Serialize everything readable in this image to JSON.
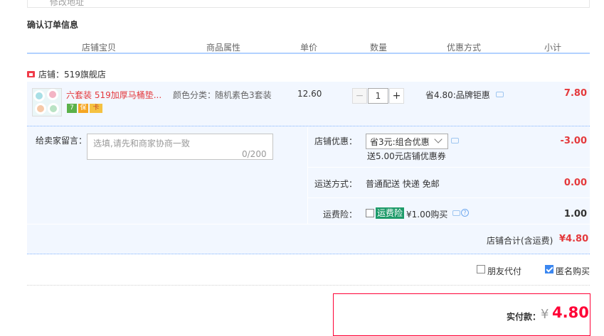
{
  "top": {
    "cut_text": "修改地址"
  },
  "section_title": "确认订单信息",
  "columns": [
    "店铺宝贝",
    "商品属性",
    "单价",
    "数量",
    "优惠方式",
    "小计"
  ],
  "store": {
    "label": "店铺：519旗舰店"
  },
  "item": {
    "title": "六套装 519加厚马桶垫...",
    "attr_label": "颜色分类：",
    "attr_value": "随机素色3套装",
    "price": "12.60",
    "qty": "1",
    "qty_minus": "−",
    "qty_plus": "+",
    "discount": "省4.80:品牌钜惠",
    "subtotal": "7.80",
    "badges": [
      "7",
      "保",
      "卡"
    ]
  },
  "message": {
    "label": "给卖家留言：",
    "placeholder": "选填,请先和商家协商一致",
    "count": "0/200"
  },
  "promo": {
    "label": "店铺优惠：",
    "selected": "省3元:组合优惠",
    "sub": "送5.00元店铺优惠券",
    "amount": "-3.00"
  },
  "shipping": {
    "label": "运送方式：",
    "value": "普通配送 快递 免邮",
    "amount": "0.00"
  },
  "insurance": {
    "label": "运费险：",
    "tag": "运费险",
    "price": "¥1.00购买",
    "amount": "1.00"
  },
  "store_total": {
    "label": "店铺合计(含运费)",
    "amount": "¥4.80"
  },
  "options": {
    "friend_pay": "朋友代付",
    "anonymous": "匿名购买"
  },
  "payment": {
    "label": "实付款：",
    "currency": "¥",
    "amount": "4.80"
  },
  "colors": {
    "price_red": "#e4393c",
    "pay_red": "#ff0036",
    "panel_bg": "#f2f7ff",
    "header_line": "#b2d1ff",
    "insurance_green": "#1e9b6a",
    "checkbox_blue": "#3b87f0"
  }
}
